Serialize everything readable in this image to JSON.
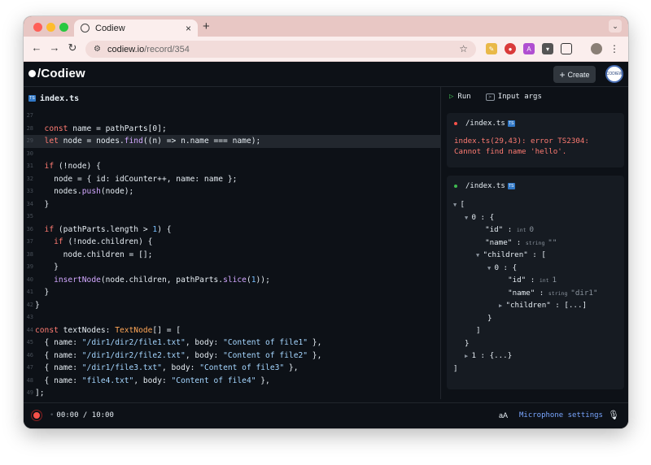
{
  "browser": {
    "tab_title": "Codiew",
    "url_host": "codiew.io",
    "url_path": "/record/354",
    "new_tab_label": "+",
    "close_tab_label": "×"
  },
  "app": {
    "logo_text": "/Codiew",
    "create_label": "Create",
    "avatar_text": "CODIEW"
  },
  "editor": {
    "filename": "index.ts",
    "ts_badge": "TS",
    "lines": [
      {
        "n": "27",
        "segs": []
      },
      {
        "n": "28",
        "segs": [
          {
            "c": "k",
            "t": "  const "
          },
          {
            "c": "v",
            "t": "name = pathParts[0];"
          }
        ]
      },
      {
        "n": "29",
        "segs": [
          {
            "c": "k",
            "t": "  let "
          },
          {
            "c": "v",
            "t": "node = nodes."
          },
          {
            "c": "f",
            "t": "find"
          },
          {
            "c": "v",
            "t": "((n) => n.name === name);"
          }
        ],
        "highlight": true
      },
      {
        "n": "30",
        "segs": []
      },
      {
        "n": "31",
        "segs": [
          {
            "c": "k",
            "t": "  if "
          },
          {
            "c": "v",
            "t": "(!node) {"
          }
        ]
      },
      {
        "n": "32",
        "segs": [
          {
            "c": "v",
            "t": "    node = { id: idCounter++, name: name };"
          }
        ]
      },
      {
        "n": "33",
        "segs": [
          {
            "c": "v",
            "t": "    nodes."
          },
          {
            "c": "f",
            "t": "push"
          },
          {
            "c": "v",
            "t": "(node);"
          }
        ]
      },
      {
        "n": "34",
        "segs": [
          {
            "c": "v",
            "t": "  }"
          }
        ]
      },
      {
        "n": "35",
        "segs": []
      },
      {
        "n": "36",
        "segs": [
          {
            "c": "k",
            "t": "  if "
          },
          {
            "c": "v",
            "t": "(pathParts.length > "
          },
          {
            "c": "n",
            "t": "1"
          },
          {
            "c": "v",
            "t": ") {"
          }
        ]
      },
      {
        "n": "37",
        "segs": [
          {
            "c": "k",
            "t": "    if "
          },
          {
            "c": "v",
            "t": "(!node.children) {"
          }
        ]
      },
      {
        "n": "38",
        "segs": [
          {
            "c": "v",
            "t": "      node.children = [];"
          }
        ]
      },
      {
        "n": "39",
        "segs": [
          {
            "c": "v",
            "t": "    }"
          }
        ]
      },
      {
        "n": "40",
        "segs": [
          {
            "c": "v",
            "t": "    "
          },
          {
            "c": "f",
            "t": "insertNode"
          },
          {
            "c": "v",
            "t": "(node.children, pathParts."
          },
          {
            "c": "f",
            "t": "slice"
          },
          {
            "c": "v",
            "t": "("
          },
          {
            "c": "n",
            "t": "1"
          },
          {
            "c": "v",
            "t": "));"
          }
        ]
      },
      {
        "n": "41",
        "segs": [
          {
            "c": "v",
            "t": "  }"
          }
        ]
      },
      {
        "n": "42",
        "segs": [
          {
            "c": "v",
            "t": "}"
          }
        ]
      },
      {
        "n": "43",
        "segs": []
      },
      {
        "n": "44",
        "segs": [
          {
            "c": "k",
            "t": "const "
          },
          {
            "c": "v",
            "t": "textNodes: "
          },
          {
            "c": "t",
            "t": "TextNode"
          },
          {
            "c": "v",
            "t": "[] = ["
          }
        ]
      },
      {
        "n": "45",
        "segs": [
          {
            "c": "v",
            "t": "  { name: "
          },
          {
            "c": "s",
            "t": "\"/dir1/dir2/file1.txt\""
          },
          {
            "c": "v",
            "t": ", body: "
          },
          {
            "c": "s",
            "t": "\"Content of file1\""
          },
          {
            "c": "v",
            "t": " },"
          }
        ]
      },
      {
        "n": "46",
        "segs": [
          {
            "c": "v",
            "t": "  { name: "
          },
          {
            "c": "s",
            "t": "\"/dir1/dir2/file2.txt\""
          },
          {
            "c": "v",
            "t": ", body: "
          },
          {
            "c": "s",
            "t": "\"Content of file2\""
          },
          {
            "c": "v",
            "t": " },"
          }
        ]
      },
      {
        "n": "47",
        "segs": [
          {
            "c": "v",
            "t": "  { name: "
          },
          {
            "c": "s",
            "t": "\"/dir1/file3.txt\""
          },
          {
            "c": "v",
            "t": ", body: "
          },
          {
            "c": "s",
            "t": "\"Content of file3\""
          },
          {
            "c": "v",
            "t": " },"
          }
        ]
      },
      {
        "n": "48",
        "segs": [
          {
            "c": "v",
            "t": "  { name: "
          },
          {
            "c": "s",
            "t": "\"file4.txt\""
          },
          {
            "c": "v",
            "t": ", body: "
          },
          {
            "c": "s",
            "t": "\"Content of file4\""
          },
          {
            "c": "v",
            "t": " },"
          }
        ]
      },
      {
        "n": "49",
        "segs": [
          {
            "c": "v",
            "t": "];"
          }
        ]
      }
    ]
  },
  "runner": {
    "run_label": "Run",
    "args_label": "Input args",
    "error_panel": {
      "title": "/index.ts",
      "dot_color": "#f85149",
      "message": "index.ts(29,43): error TS2304:\nCannot find name 'hello'."
    },
    "output_panel": {
      "title": "/index.ts",
      "dot_color": "#3fb950",
      "tree": [
        {
          "indent": 0,
          "tri": "▼",
          "text": "["
        },
        {
          "indent": 1,
          "tri": "▼",
          "text": "0 : {"
        },
        {
          "indent": 2,
          "key": "\"id\"",
          "type": "int",
          "val": "0"
        },
        {
          "indent": 2,
          "key": "\"name\"",
          "type": "string",
          "val": "\"\""
        },
        {
          "indent": 2,
          "tri": "▼",
          "text": "\"children\" : ["
        },
        {
          "indent": 3,
          "tri": "▼",
          "text": "0 : {"
        },
        {
          "indent": 4,
          "key": "\"id\"",
          "type": "int",
          "val": "1"
        },
        {
          "indent": 4,
          "key": "\"name\"",
          "type": "string",
          "val": "\"dir1\""
        },
        {
          "indent": 4,
          "tri": "▶",
          "text": "\"children\" : [...]"
        },
        {
          "indent": 3,
          "text": "}"
        },
        {
          "indent": 2,
          "text": "]"
        },
        {
          "indent": 1,
          "text": "}"
        },
        {
          "indent": 1,
          "tri": "▶",
          "text": "1 : {...}"
        },
        {
          "indent": 0,
          "text": "]"
        }
      ]
    }
  },
  "bottom": {
    "time": "00:00 / 10:00",
    "font_toggle": "aA",
    "mic_settings": "Microphone settings"
  }
}
